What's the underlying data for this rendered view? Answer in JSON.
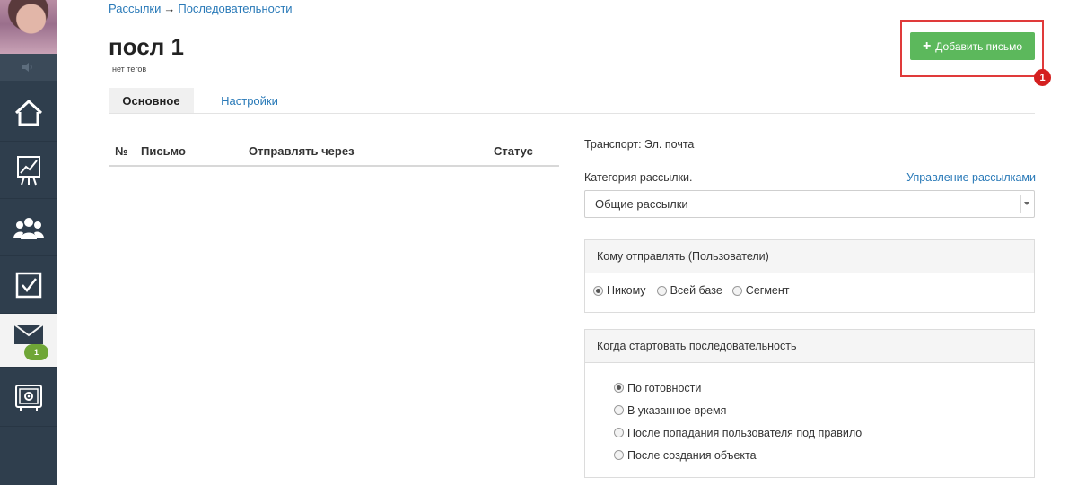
{
  "breadcrumb": {
    "parent": "Рассылки",
    "separator": "→",
    "current": "Последовательности"
  },
  "page": {
    "title": "посл 1",
    "tags": "нет тегов"
  },
  "actions": {
    "add_letter": "Добавить письмо",
    "add_icon": "plus-icon",
    "marker": "1"
  },
  "tabs": [
    {
      "label": "Основное",
      "active": true
    },
    {
      "label": "Настройки",
      "active": false
    }
  ],
  "table": {
    "headers": [
      "№",
      "Письмо",
      "Отправлять через",
      "Статус"
    ],
    "rows": []
  },
  "transport": "Транспорт: Эл. почта",
  "category": {
    "label": "Категория рассылки.",
    "manage_link": "Управление рассылками",
    "selected": "Общие рассылки"
  },
  "recipients": {
    "heading": "Кому отправлять (Пользователи)",
    "options": [
      {
        "label": "Никому",
        "checked": true
      },
      {
        "label": "Всей базе",
        "checked": false
      },
      {
        "label": "Сегмент",
        "checked": false
      }
    ]
  },
  "start": {
    "heading": "Когда стартовать последовательность",
    "options": [
      {
        "label": "По готовности",
        "checked": true
      },
      {
        "label": "В указанное время",
        "checked": false
      },
      {
        "label": "После попадания пользователя под правило",
        "checked": false
      },
      {
        "label": "После создания объекта",
        "checked": false
      }
    ]
  },
  "sidebar": {
    "mail_badge": "1",
    "items": [
      "home-icon",
      "chart-icon",
      "users-icon",
      "tasks-icon",
      "mail-icon",
      "settings-icon"
    ]
  },
  "colors": {
    "sidebar": "#2f3e4d",
    "link": "#2a7ab8",
    "primary_button": "#5cb85c",
    "highlight": "#e03a3a",
    "badge": "#6fa637"
  }
}
